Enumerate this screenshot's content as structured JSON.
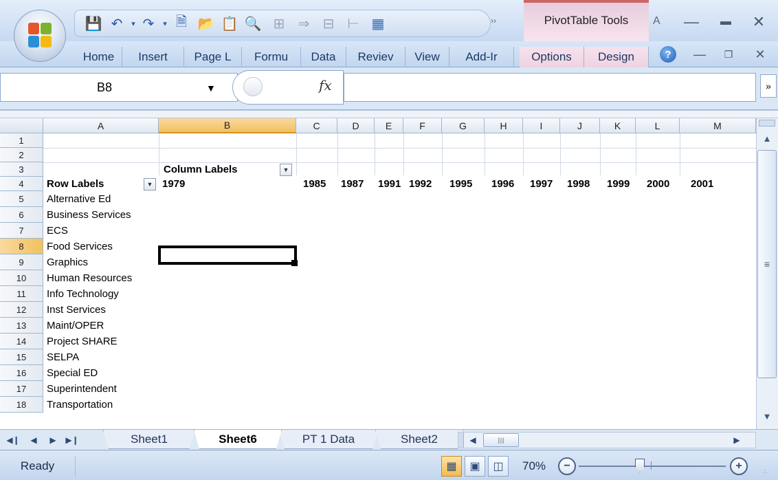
{
  "title_bar": {
    "contextual_tab": "PivotTable Tools",
    "title_fragment": "A"
  },
  "ribbon_tabs": [
    "Home",
    "Insert",
    "Page L",
    "Formu",
    "Data",
    "Reviev",
    "View",
    "Add-Ir",
    "Options",
    "Design"
  ],
  "formula_bar": {
    "name_box": "B8",
    "fx_label": "fx",
    "content": ""
  },
  "columns": [
    "A",
    "B",
    "C",
    "D",
    "E",
    "F",
    "G",
    "H",
    "I",
    "J",
    "K",
    "L",
    "M"
  ],
  "selected_column": "B",
  "selected_row": "8",
  "rows": [
    "1",
    "2",
    "3",
    "4",
    "5",
    "6",
    "7",
    "8",
    "9",
    "10",
    "11",
    "12",
    "13",
    "14",
    "15",
    "16",
    "17",
    "18"
  ],
  "pivot": {
    "column_labels_header": "Column Labels",
    "row_labels_header": "Row Labels",
    "years": [
      "1979",
      "1985",
      "1987",
      "1991",
      "1992",
      "1995",
      "1996",
      "1997",
      "1998",
      "1999",
      "2000",
      "2001"
    ],
    "row_items": [
      "Alternative Ed",
      "Business Services",
      "ECS",
      "Food Services",
      "Graphics",
      "Human Resources",
      "Info Technology",
      "Inst Services",
      "Maint/OPER",
      "Project SHARE",
      "SELPA",
      "Special ED",
      "Superintendent",
      "Transportation"
    ]
  },
  "sheet_tabs": [
    "Sheet1",
    "Sheet6",
    "PT 1 Data",
    "Sheet2"
  ],
  "active_sheet": "Sheet6",
  "status_bar": {
    "status": "Ready",
    "zoom": "70%"
  }
}
